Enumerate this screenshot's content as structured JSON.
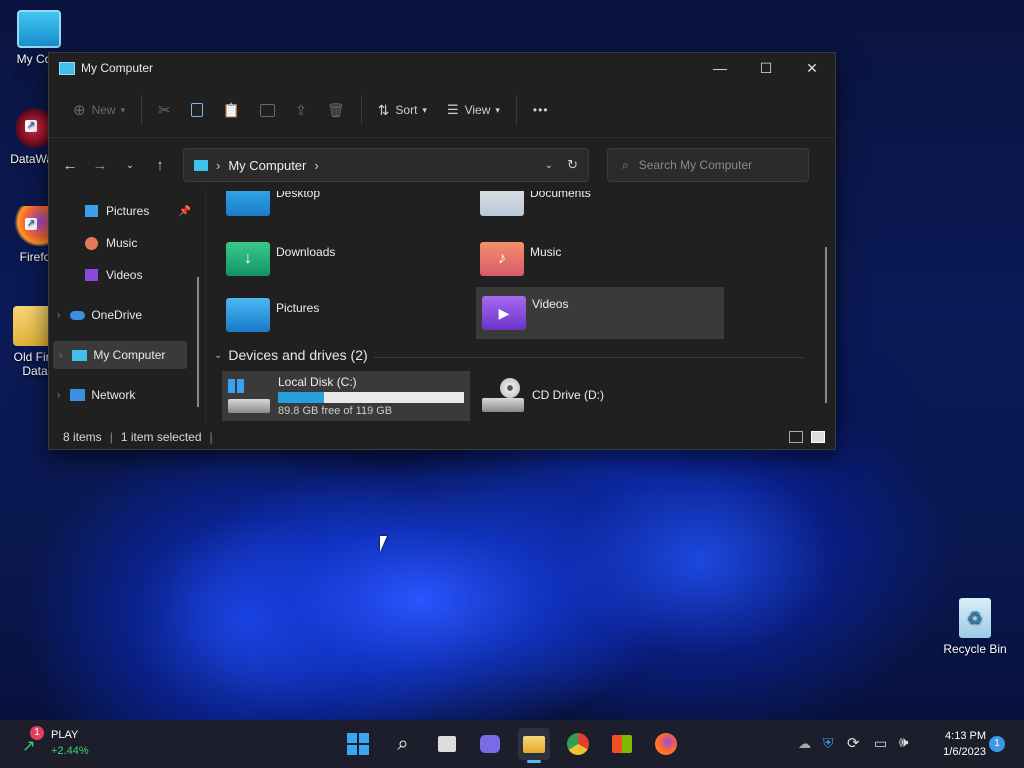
{
  "desktop": {
    "icons": [
      {
        "label": "My Com"
      },
      {
        "label": "DataWag"
      },
      {
        "label": "Firefo"
      },
      {
        "label": "Old Fire\nData"
      },
      {
        "label": "Recycle Bin"
      }
    ]
  },
  "window": {
    "title": "My Computer",
    "controls": {
      "minimize": "—",
      "maximize": "☐",
      "close": "✕"
    },
    "toolbar": {
      "new_label": "New",
      "sort_label": "Sort",
      "view_label": "View",
      "more_label": "•••"
    },
    "address": {
      "path": "My Computer",
      "search_placeholder": "Search My Computer"
    },
    "nav": {
      "items": [
        {
          "label": "Pictures"
        },
        {
          "label": "Music"
        },
        {
          "label": "Videos"
        },
        {
          "label": "OneDrive"
        },
        {
          "label": "My Computer"
        },
        {
          "label": "Network"
        }
      ]
    },
    "content": {
      "folders": [
        {
          "label": "Desktop"
        },
        {
          "label": "Documents"
        },
        {
          "label": "Downloads"
        },
        {
          "label": "Music"
        },
        {
          "label": "Pictures"
        },
        {
          "label": "Videos"
        }
      ],
      "section_title": "Devices and drives (2)",
      "drives": [
        {
          "label": "Local Disk (C:)",
          "free_text": "89.8 GB free of 119 GB",
          "used_fraction": 0.245
        },
        {
          "label": "CD Drive (D:)"
        }
      ]
    },
    "status": {
      "items_count": "8 items",
      "selection": "1 item selected"
    }
  },
  "taskbar": {
    "widget": {
      "badge": "1",
      "title": "PLAY",
      "change": "+2.44%"
    },
    "clock": {
      "time": "4:13 PM",
      "date": "1/6/2023"
    },
    "notification_badge": "1"
  },
  "colors": {
    "accent": "#27a0dd",
    "window_bg": "#202020",
    "selected_bg": "#3a3a3a",
    "taskbar_bg": "#1c1f2b",
    "change_positive": "#3dd36b"
  }
}
